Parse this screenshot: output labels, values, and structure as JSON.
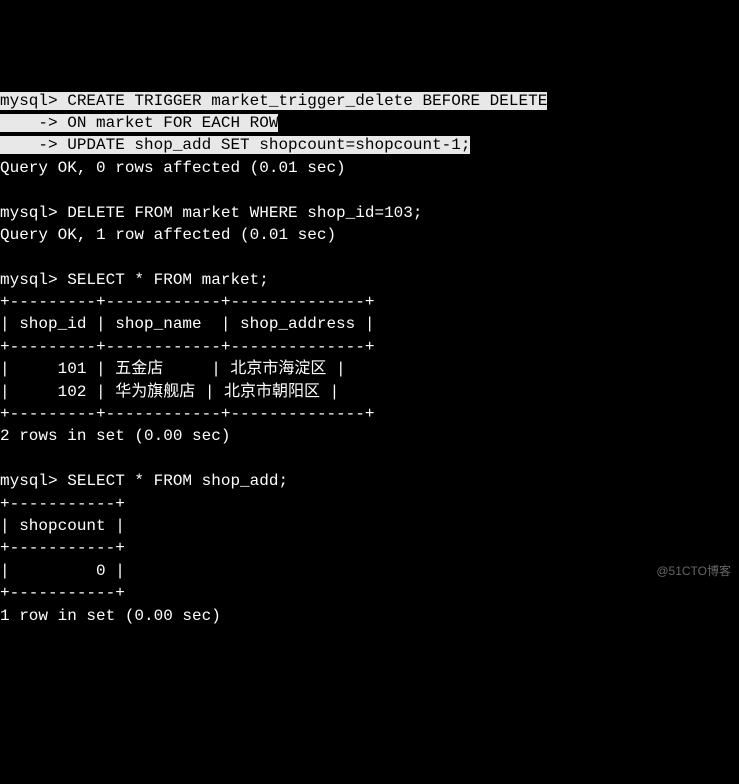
{
  "prompt": "mysql>",
  "cont": "    ->",
  "commands": {
    "create_trigger_l1": " CREATE TRIGGER market_trigger_delete BEFORE DELETE",
    "create_trigger_l2": " ON market FOR EACH ROW",
    "create_trigger_l3": " UPDATE shop_add SET shopcount=shopcount-1;",
    "delete_cmd": " DELETE FROM market WHERE shop_id=103;",
    "select_market": " SELECT * FROM market;",
    "select_shop_add": " SELECT * FROM shop_add;"
  },
  "results": {
    "ok_0rows": "Query OK, 0 rows affected (0.01 sec)",
    "ok_1row": "Query OK, 1 row affected (0.01 sec)",
    "rows2": "2 rows in set (0.00 sec)",
    "rows1": "1 row in set (0.00 sec)"
  },
  "table_market": {
    "border": "+---------+------------+--------------+",
    "header": "| shop_id | shop_name  | shop_address |",
    "row1": "|     101 | 五金店     | 北京市海淀区 |",
    "row2": "|     102 | 华为旗舰店 | 北京市朝阳区 |"
  },
  "table_shop_add": {
    "border": "+-----------+",
    "header": "| shopcount |",
    "row1": "|         0 |"
  },
  "watermark": "@51CTO博客"
}
